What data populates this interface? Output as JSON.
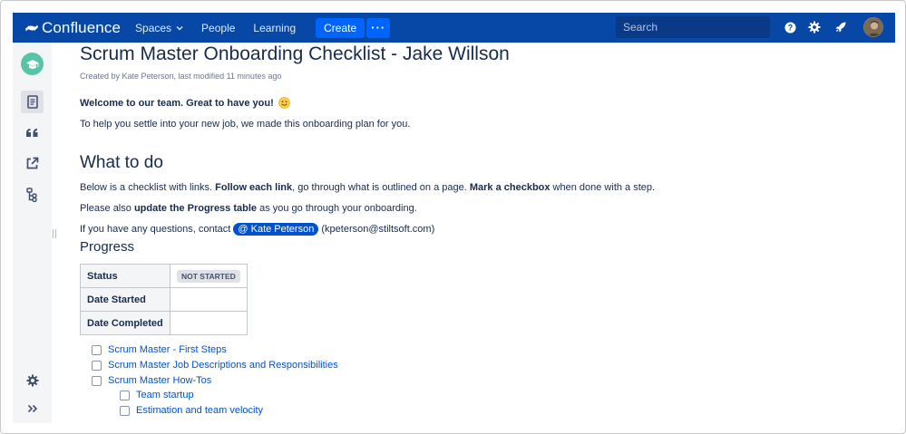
{
  "nav": {
    "logo_text": "Confluence",
    "items": [
      "Spaces",
      "People",
      "Learning"
    ],
    "create_label": "Create",
    "search_placeholder": "Search"
  },
  "page": {
    "title": "Scrum Master Onboarding Checklist - Jake Willson",
    "byline": "Created by Kate Peterson, last modified 11 minutes ago",
    "welcome": "Welcome to our team. Great to have you!",
    "intro": "To help you settle into your new job, we made this onboarding plan for you.",
    "what_heading": "What to do",
    "line1": {
      "a": "Below is a checklist with links. ",
      "b": "Follow each link",
      "c": ", go through what is outlined on a page. ",
      "d": "Mark a checkbox",
      "e": " when done with a step."
    },
    "line2": {
      "a": "Please also ",
      "b": "update the Progress table",
      "c": " as you go through your onboarding."
    },
    "line3": {
      "a": "If you have any questions, contact ",
      "mention": "@ Kate Peterson",
      "c": " (kpeterson@stiltsoft.com)"
    },
    "progress_heading": "Progress"
  },
  "progress_table": {
    "status_label": "Status",
    "status_value": "NOT STARTED",
    "started_label": "Date Started",
    "started_value": "",
    "completed_label": "Date Completed",
    "completed_value": ""
  },
  "tasks": [
    {
      "label": "Scrum Master - First Steps",
      "checked": false
    },
    {
      "label": "Scrum Master Job Descriptions and Responsibilities",
      "checked": false
    },
    {
      "label": "Scrum Master How-Tos",
      "checked": false
    },
    {
      "label": "Team startup",
      "checked": false
    },
    {
      "label": "Estimation and team velocity",
      "checked": false
    }
  ],
  "colors": {
    "nav_bg": "#0747a6",
    "create_bg": "#0065ff",
    "link": "#0052cc",
    "space_logo": "#57c4a8"
  },
  "icons": [
    "confluence-logo-icon",
    "caret-down-icon",
    "search-icon",
    "help-icon",
    "gear-icon",
    "notification-icon",
    "avatar",
    "graduation-cap-icon",
    "page-icon",
    "quote-icon",
    "external-link-icon",
    "tree-icon",
    "settings-icon",
    "expand-icon",
    "smile-emoji-icon"
  ]
}
